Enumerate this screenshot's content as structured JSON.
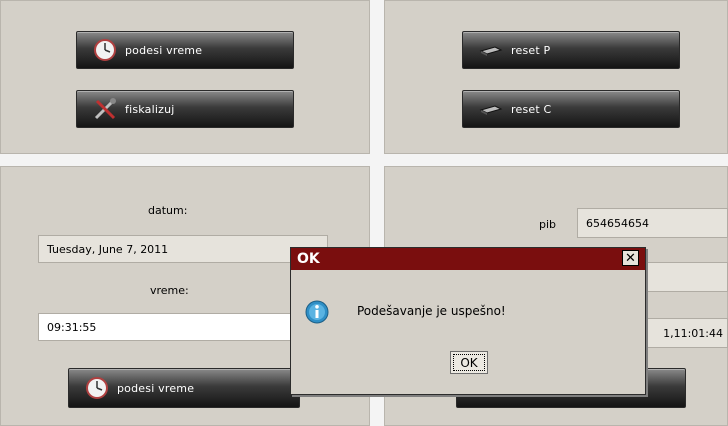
{
  "top_left": {
    "buttons": [
      {
        "label": "podesi vreme",
        "icon": "clock-icon"
      },
      {
        "label": "fiskalizuj",
        "icon": "tools-icon"
      }
    ]
  },
  "top_right": {
    "buttons": [
      {
        "label": "reset P",
        "icon": "device-icon"
      },
      {
        "label": "reset C",
        "icon": "device-icon"
      }
    ]
  },
  "bottom_left": {
    "date_label": "datum:",
    "date_value": "Tuesday, June 7, 2011",
    "time_label": "vreme:",
    "time_value": "09:31:55",
    "button_label": "podesi vreme"
  },
  "bottom_right": {
    "pib_label": "pib",
    "pib_value": "654654654",
    "field2_value": "",
    "datetime_value": "1,11:01:44"
  },
  "dialog": {
    "title": "OK",
    "close_glyph": "✕",
    "message": "Podešavanje je uspešno!",
    "ok_label": "OK"
  },
  "colors": {
    "background": "#d4d0c8",
    "dialog_title": "#7a0e0e",
    "button_dark": "#1f1f1f"
  }
}
